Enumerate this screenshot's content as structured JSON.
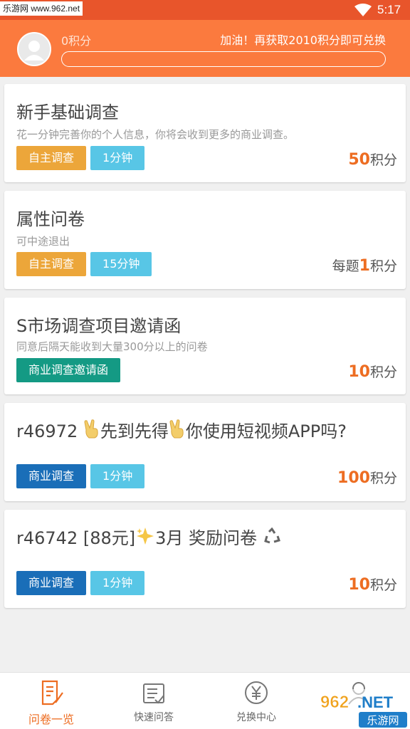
{
  "status_bar": {
    "watermark": "乐游网 www.962.net",
    "time": "5:17",
    "icons": [
      "wifi-icon"
    ]
  },
  "header": {
    "points_label": "0积分",
    "tip": "加油！再获取2010积分即可兑换",
    "progress": 0,
    "colors": {
      "bar": "#fb7a3e",
      "status": "#e8552b"
    }
  },
  "surveys": [
    {
      "title": "新手基础调查",
      "desc": "花一分钟完善你的个人信息，你将会收到更多的商业调查。",
      "tags": [
        {
          "label": "自主调查",
          "color": "#eca63a"
        },
        {
          "label": "1分钟",
          "color": "#58c6e6"
        }
      ],
      "reward_prefix": "",
      "reward_num": "50",
      "reward_unit": "积分"
    },
    {
      "title": "属性问卷",
      "desc": "可中途退出",
      "tags": [
        {
          "label": "自主调查",
          "color": "#eca63a"
        },
        {
          "label": "15分钟",
          "color": "#58c6e6"
        }
      ],
      "reward_prefix": "每题",
      "reward_num": "1",
      "reward_unit": "积分"
    },
    {
      "title": "S市场调查项目邀请函",
      "desc": "同意后隔天能收到大量300分以上的问卷",
      "tags": [
        {
          "label": "商业调查邀请函",
          "color": "#149a84"
        }
      ],
      "reward_prefix": "",
      "reward_num": "10",
      "reward_unit": "积分"
    },
    {
      "title_a": "r46972 ",
      "title_b": "先到先得",
      "title_c": "你使用短视频APP吗?",
      "icons": [
        "victory-hand-icon",
        "victory-hand-icon"
      ],
      "tags": [
        {
          "label": "商业调查",
          "color": "#1a6eb8"
        },
        {
          "label": "1分钟",
          "color": "#58c6e6"
        }
      ],
      "reward_prefix": "",
      "reward_num": "100",
      "reward_unit": "积分"
    },
    {
      "title_a": "r46742 [88元]",
      "title_b": "3月 奖励问卷 ",
      "icons": [
        "sparkle-icon",
        "recycle-icon"
      ],
      "tags": [
        {
          "label": "商业调查",
          "color": "#1a6eb8"
        },
        {
          "label": "1分钟",
          "color": "#58c6e6"
        }
      ],
      "reward_prefix": "",
      "reward_num": "10",
      "reward_unit": "积分"
    }
  ],
  "bottom_nav": [
    {
      "label": "问卷一览",
      "icon": "survey-list-icon",
      "active": true
    },
    {
      "label": "快速问答",
      "icon": "checklist-icon",
      "active": false
    },
    {
      "label": "兑换中心",
      "icon": "yen-icon",
      "active": false
    },
    {
      "label": "",
      "icon": "user-icon",
      "active": false
    }
  ],
  "watermark_bottom": "962.NET 乐游网",
  "accent": "#ed6d22"
}
